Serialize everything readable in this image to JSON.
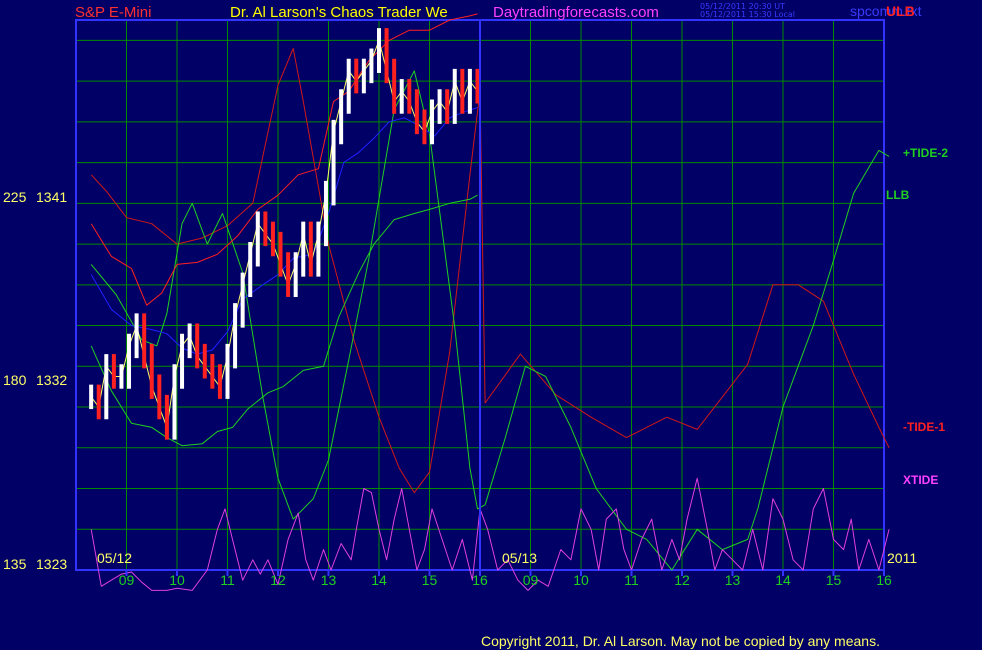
{
  "header": {
    "market": "S&P E-Mini",
    "title": "Dr. Al Larson's Chaos Trader We",
    "site": "Daytradingforecasts.com",
    "time_line_1": "05/12/2011 20:30 UT",
    "time_line_2": "05/12/2011 15:30 Local",
    "file": "spcomm.txt",
    "ulb": "ULB"
  },
  "footer": {
    "copyright": "Copyright 2011, Dr. Al Larson. May not be copied by any means."
  },
  "colors": {
    "background": "#000066",
    "grid": "#008a00",
    "frame": "#3333ff",
    "price_up": "#ffffff",
    "price_down": "#ff2020",
    "tide_minus_1": "#d01818",
    "tide_plus_2": "#20d020",
    "xtide": "#e040e0",
    "envelope": "#ff2020",
    "moving_avg": "#2020ff"
  },
  "chart_data": {
    "type": "line",
    "title": "S&P E-Mini",
    "y_axis": {
      "ylim": [
        1323,
        1350
      ],
      "tick_labels": [
        {
          "value": 1341,
          "left": "225",
          "right": "1341"
        },
        {
          "value": 1332,
          "left": "180",
          "right": "1332"
        },
        {
          "value": 1323,
          "left": "135",
          "right": "1323"
        }
      ]
    },
    "x_axis": {
      "hour_ticks": [
        "09",
        "10",
        "11",
        "12",
        "13",
        "14",
        "15",
        "16",
        "09",
        "10",
        "11",
        "12",
        "13",
        "14",
        "15",
        "16"
      ],
      "date_labels": [
        "05/12",
        "05/13"
      ],
      "year_label": "2011"
    },
    "grid": true,
    "series": [
      {
        "name": "-TIDE-1",
        "x": [
          8.3,
          8.6,
          9.0,
          9.5,
          10.0,
          10.5,
          11.0,
          11.5,
          12.0,
          12.3,
          12.5,
          13.0,
          13.5,
          14.0,
          14.4,
          14.7,
          15.0,
          15.4,
          15.8,
          16.0,
          16.1,
          16.8,
          17.5,
          18.2,
          18.9,
          19.7,
          20.3,
          20.8,
          21.3,
          21.8,
          22.3,
          22.8,
          23.4,
          23.9,
          24.1
        ],
        "values": [
          1342.4,
          1341.6,
          1340.3,
          1340.0,
          1339.0,
          1339.3,
          1339.9,
          1341.0,
          1346.8,
          1348.6,
          1346.0,
          1339.0,
          1334.3,
          1330.5,
          1328.0,
          1326.8,
          1327.8,
          1333.7,
          1342.4,
          1346.5,
          1331.2,
          1333.6,
          1331.6,
          1330.5,
          1329.5,
          1330.5,
          1329.9,
          1331.5,
          1333.1,
          1337.0,
          1337.0,
          1336.2,
          1332.6,
          1330.0,
          1329.0
        ]
      },
      {
        "name": "+TIDE-2",
        "x": [
          8.3,
          8.8,
          9.3,
          9.6,
          9.8,
          10.1,
          10.3,
          10.6,
          10.9,
          11.3,
          11.7,
          12.0,
          12.3,
          12.7,
          13.0,
          13.4,
          13.8,
          14.3,
          14.7,
          15.0,
          15.5,
          15.8,
          15.95,
          16.1,
          16.5,
          16.9,
          17.3,
          17.8,
          18.3,
          18.9,
          19.3,
          19.8,
          20.3,
          20.8,
          21.3,
          21.5,
          22.0,
          22.6,
          23.0,
          23.4,
          23.9,
          24.1
        ],
        "values": [
          1338.0,
          1336.5,
          1334.3,
          1334.0,
          1335.6,
          1340.0,
          1341.0,
          1339.0,
          1340.5,
          1337.6,
          1331.5,
          1327.5,
          1325.5,
          1326.5,
          1328.4,
          1333.3,
          1338.3,
          1345.6,
          1347.5,
          1344.4,
          1334.9,
          1328.0,
          1326.0,
          1326.2,
          1329.5,
          1333.0,
          1332.5,
          1330.0,
          1327.0,
          1325.0,
          1324.5,
          1323.0,
          1325.0,
          1324.0,
          1324.5,
          1326.0,
          1331.0,
          1335.0,
          1338.2,
          1341.5,
          1343.6,
          1343.3
        ]
      },
      {
        "name": "XTIDE",
        "x": [
          8.3,
          8.5,
          8.7,
          8.9,
          9.1,
          9.3,
          9.5,
          9.8,
          10.0,
          10.3,
          10.6,
          10.8,
          10.95,
          11.1,
          11.3,
          11.5,
          11.65,
          11.8,
          12.0,
          12.2,
          12.4,
          12.55,
          12.7,
          12.9,
          13.05,
          13.25,
          13.45,
          13.55,
          13.7,
          13.85,
          14.0,
          14.15,
          14.3,
          14.45,
          14.6,
          14.75,
          14.9,
          15.05,
          15.25,
          15.45,
          15.65,
          15.85,
          16.0,
          16.15,
          16.35,
          16.55,
          16.75,
          16.95,
          17.15,
          17.35,
          17.6,
          17.8,
          18.0,
          18.2,
          18.35,
          18.5,
          18.7,
          18.85,
          19.0,
          19.2,
          19.4,
          19.6,
          19.8,
          19.95,
          20.1,
          20.3,
          20.5,
          20.65,
          20.8,
          21.0,
          21.2,
          21.4,
          21.6,
          21.8,
          22.0,
          22.2,
          22.4,
          22.6,
          22.8,
          23.0,
          23.2,
          23.35,
          23.5,
          23.7,
          23.9,
          24.1
        ],
        "values": [
          1325.0,
          1322.2,
          1322.5,
          1322.8,
          1322.9,
          1322.4,
          1322.0,
          1322.0,
          1322.1,
          1322.0,
          1323.0,
          1325.0,
          1326.0,
          1324.5,
          1322.5,
          1323.5,
          1322.8,
          1323.5,
          1322.3,
          1324.5,
          1325.8,
          1323.5,
          1322.5,
          1324.0,
          1323.0,
          1324.3,
          1323.5,
          1325.0,
          1327.0,
          1326.8,
          1325.0,
          1323.5,
          1325.5,
          1327.0,
          1325.0,
          1323.0,
          1324.0,
          1326.0,
          1324.5,
          1323.0,
          1324.5,
          1322.5,
          1326.0,
          1325.0,
          1323.0,
          1323.5,
          1322.5,
          1322.0,
          1322.5,
          1322.2,
          1324.0,
          1323.5,
          1326.0,
          1325.0,
          1323.0,
          1325.5,
          1326.0,
          1324.0,
          1323.0,
          1324.5,
          1325.5,
          1323.0,
          1324.5,
          1323.5,
          1325.5,
          1327.5,
          1325.0,
          1323.0,
          1324.0,
          1323.5,
          1323.0,
          1325.0,
          1323.0,
          1326.5,
          1325.5,
          1323.5,
          1323.0,
          1326.0,
          1327.0,
          1324.5,
          1324.0,
          1325.5,
          1323.0,
          1324.5,
          1323.0,
          1325.0
        ]
      },
      {
        "name": "Moving average",
        "x": [
          8.3,
          8.7,
          9.1,
          9.5,
          9.8,
          10.1,
          10.4,
          10.7,
          11.0,
          11.3,
          11.7,
          12.0,
          12.3,
          12.7,
          13.0,
          13.3,
          13.6,
          13.9,
          14.2,
          14.5,
          14.8,
          15.1,
          15.4,
          15.7,
          15.95
        ],
        "values": [
          1337.5,
          1335.8,
          1335.0,
          1334.8,
          1334.6,
          1333.9,
          1333.6,
          1333.8,
          1334.7,
          1336.3,
          1337.0,
          1337.5,
          1338.3,
          1338.5,
          1340.5,
          1343.0,
          1343.5,
          1344.2,
          1345.0,
          1345.2,
          1344.8,
          1344.3,
          1345.2,
          1345.5,
          1345.7
        ]
      },
      {
        "name": "Lower band",
        "x": [
          8.3,
          8.7,
          9.1,
          9.5,
          9.8,
          10.1,
          10.5,
          10.8,
          11.1,
          11.4,
          11.8,
          12.1,
          12.5,
          12.9,
          13.2,
          13.6,
          13.9,
          14.3,
          14.7,
          15.0,
          15.4,
          15.8,
          15.95
        ],
        "values": [
          1334.0,
          1331.8,
          1330.2,
          1330.0,
          1329.5,
          1329.1,
          1329.2,
          1329.8,
          1330.0,
          1330.9,
          1331.7,
          1332.0,
          1332.8,
          1333.0,
          1335.4,
          1337.6,
          1339.0,
          1340.2,
          1340.5,
          1340.7,
          1341.0,
          1341.2,
          1341.4
        ]
      },
      {
        "name": "Upper band",
        "x": [
          8.3,
          8.7,
          9.1,
          9.4,
          9.7,
          10.0,
          10.4,
          10.8,
          11.2,
          11.6,
          12.0,
          12.4,
          12.8,
          13.1,
          13.4,
          13.8,
          14.2,
          14.6,
          15.0,
          15.4,
          15.8,
          15.95
        ],
        "values": [
          1340.0,
          1338.4,
          1337.8,
          1336.0,
          1336.6,
          1338.0,
          1338.1,
          1338.5,
          1339.4,
          1340.7,
          1341.4,
          1342.4,
          1342.7,
          1346.0,
          1346.5,
          1348.0,
          1349.0,
          1349.5,
          1349.5,
          1350.0,
          1350.2,
          1350.3
        ]
      },
      {
        "name": "Price",
        "x": [
          8.3,
          8.45,
          8.6,
          8.75,
          8.9,
          9.05,
          9.2,
          9.35,
          9.5,
          9.65,
          9.8,
          9.95,
          10.1,
          10.25,
          10.4,
          10.55,
          10.7,
          10.85,
          11.0,
          11.15,
          11.3,
          11.45,
          11.6,
          11.75,
          11.9,
          12.05,
          12.2,
          12.35,
          12.5,
          12.65,
          12.8,
          12.95,
          13.1,
          13.25,
          13.4,
          13.55,
          13.7,
          13.85,
          14.0,
          14.15,
          14.3,
          14.45,
          14.6,
          14.75,
          14.9,
          15.05,
          15.2,
          15.35,
          15.5,
          15.65,
          15.8,
          15.95
        ],
        "values": [
          1331.5,
          1331.0,
          1333.0,
          1332.5,
          1332.5,
          1334.0,
          1335.0,
          1333.5,
          1332.0,
          1331.0,
          1330.0,
          1332.5,
          1334.0,
          1334.5,
          1333.5,
          1333.0,
          1332.5,
          1332.0,
          1333.5,
          1335.5,
          1337.0,
          1338.5,
          1340.0,
          1339.5,
          1339.0,
          1338.0,
          1337.0,
          1338.0,
          1339.5,
          1338.0,
          1339.5,
          1341.5,
          1344.5,
          1346.0,
          1347.5,
          1347.0,
          1347.5,
          1348.0,
          1349.0,
          1347.5,
          1346.0,
          1346.5,
          1346.0,
          1345.0,
          1344.5,
          1345.5,
          1346.0,
          1345.5,
          1347.0,
          1346.0,
          1347.0,
          1346.5
        ]
      }
    ],
    "series_labels": [
      "ULB",
      "+TIDE-2",
      "LLB",
      "-TIDE-1",
      "XTIDE"
    ],
    "events": [
      {
        "name": "now line",
        "x": 16.0
      }
    ]
  }
}
